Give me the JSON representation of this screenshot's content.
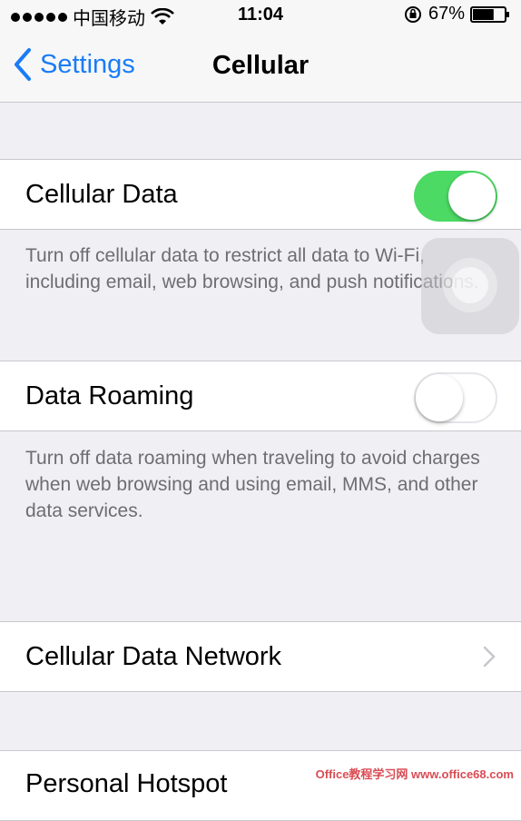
{
  "status_bar": {
    "carrier": "中国移动",
    "time": "11:04",
    "battery_percent": "67%",
    "battery_level": 0.67
  },
  "nav": {
    "back_label": "Settings",
    "title": "Cellular"
  },
  "cells": {
    "cellular_data": {
      "label": "Cellular Data",
      "on": true
    },
    "cellular_data_footer": "Turn off cellular data to restrict all data to Wi-Fi, including email, web browsing, and push notifications.",
    "data_roaming": {
      "label": "Data Roaming",
      "on": false
    },
    "data_roaming_footer": "Turn off data roaming when traveling to avoid charges when web browsing and using email, MMS, and other data services.",
    "cellular_data_network": {
      "label": "Cellular Data Network"
    },
    "personal_hotspot": {
      "label": "Personal Hotspot"
    }
  },
  "watermark": "Office教程学习网 www.office68.com",
  "colors": {
    "accent": "#1a7cf5",
    "switch_on": "#4cd964",
    "background": "#efeff4"
  }
}
